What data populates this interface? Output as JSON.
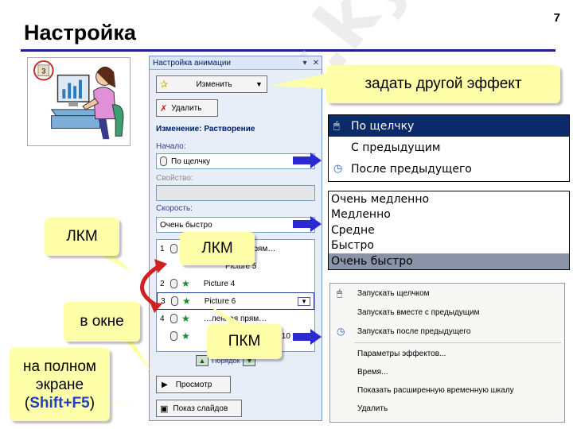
{
  "slide": {
    "title": "Настройка",
    "number": "7",
    "watermark": "www.kyte.ru"
  },
  "taskpane": {
    "title": "Настройка анимации",
    "change_button": "Изменить",
    "delete_button": "Удалить",
    "effect_heading": "Изменение: Растворение",
    "start_label": "Начало:",
    "start_value": "По щелчку",
    "property_label": "Свойство:",
    "speed_label": "Скорость:",
    "speed_value": "Очень быстро",
    "list": [
      {
        "num": "1",
        "name": "…ная прям…"
      },
      {
        "num": "",
        "name": "Picture 5"
      },
      {
        "num": "2",
        "name": "Picture 4"
      },
      {
        "num": "3",
        "name": "Picture 6"
      },
      {
        "num": "4",
        "name": "…ленная прям…"
      },
      {
        "num": "",
        "name": "…10"
      }
    ],
    "reorder_label": "Порядок",
    "preview_button": "Просмотр",
    "slideshow_button": "Показ слайдов"
  },
  "callouts": {
    "other_effect": "задать другой эффект",
    "lmb_left": "ЛКМ",
    "lmb_middle": "ЛКМ",
    "rmb": "ПКМ",
    "in_window": "в окне",
    "fullscreen_line1": "на полном",
    "fullscreen_line2": "экране",
    "fullscreen_key_open": "(",
    "fullscreen_key": "Shift+F5",
    "fullscreen_key_close": ")"
  },
  "start_dropdown": [
    "По щелчку",
    "С предыдущим",
    "После предыдущего"
  ],
  "speed_dropdown": [
    "Очень медленно",
    "Медленно",
    "Средне",
    "Быстро",
    "Очень быстро"
  ],
  "context_menu": [
    "Запускать щелчком",
    "Запускать вместе с предыдущим",
    "Запускать после предыдущего",
    "Параметры эффектов...",
    "Время...",
    "Показать расширенную временную шкалу",
    "Удалить"
  ],
  "clipart_badge": "3",
  "colors": {
    "accent_blue": "#2040c0",
    "callout_fill": "#ffffaa",
    "selection": "#0b2a6a"
  }
}
